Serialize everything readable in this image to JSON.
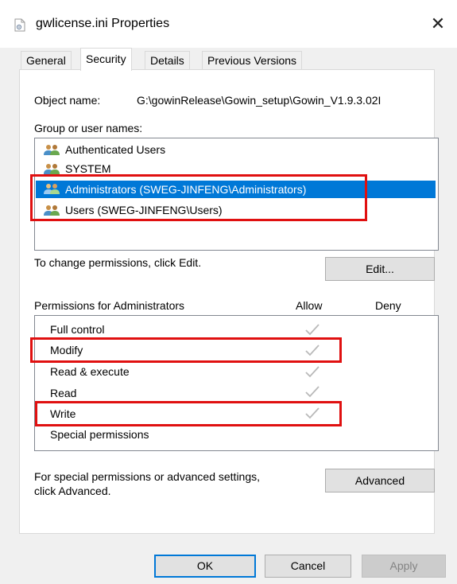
{
  "window": {
    "title": "gwlicense.ini Properties",
    "close_glyph": "✕"
  },
  "tabs": [
    {
      "label": "General"
    },
    {
      "label": "Security"
    },
    {
      "label": "Details"
    },
    {
      "label": "Previous Versions"
    }
  ],
  "object": {
    "label": "Object name:",
    "value": "G:\\gowinRelease\\Gowin_setup\\Gowin_V1.9.3.02I"
  },
  "groups": {
    "label": "Group or user names:",
    "items": [
      {
        "name": "Authenticated Users",
        "icon": "users-icon"
      },
      {
        "name": "SYSTEM",
        "icon": "users-icon"
      },
      {
        "name": "Administrators (SWEG-JINFENG\\Administrators)",
        "icon": "users-icon",
        "selected": true
      },
      {
        "name": "Users (SWEG-JINFENG\\Users)",
        "icon": "users-icon"
      }
    ]
  },
  "change_text": "To change permissions, click Edit.",
  "edit_button": "Edit...",
  "permissions": {
    "label": "Permissions for Administrators",
    "allow_header": "Allow",
    "deny_header": "Deny",
    "items": [
      {
        "name": "Full control",
        "allow": true
      },
      {
        "name": "Modify",
        "allow": true
      },
      {
        "name": "Read & execute",
        "allow": true
      },
      {
        "name": "Read",
        "allow": true
      },
      {
        "name": "Write",
        "allow": true
      },
      {
        "name": "Special permissions",
        "allow": false
      }
    ]
  },
  "advanced_text": {
    "line1": "For special permissions or advanced settings,",
    "line2": "click Advanced."
  },
  "advanced_button": "Advanced",
  "buttons": {
    "ok": "OK",
    "cancel": "Cancel",
    "apply": "Apply"
  },
  "colors": {
    "selection": "#0078d7",
    "highlight_box": "#e01010",
    "check_gray": "#b9b9b9"
  }
}
